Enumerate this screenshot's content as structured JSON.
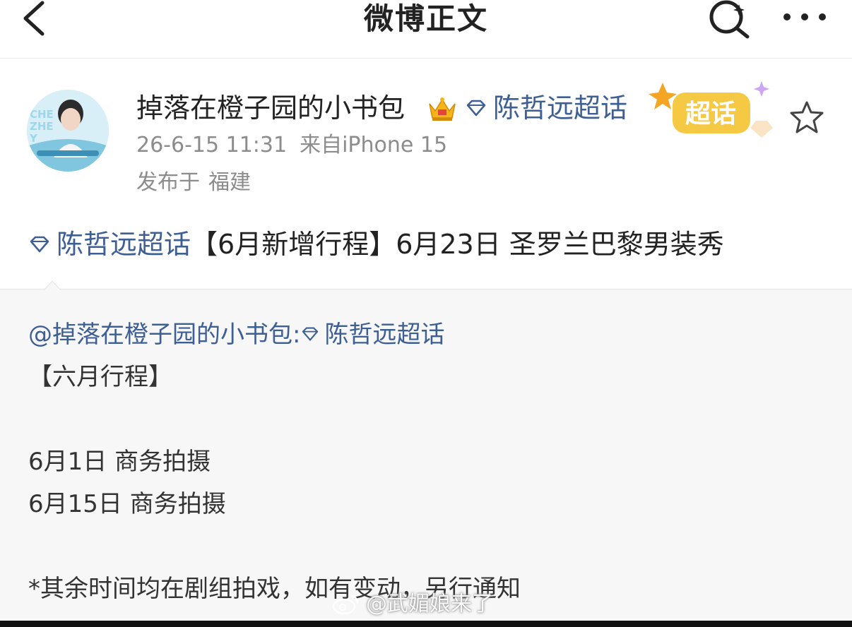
{
  "nav": {
    "title": "微博正文",
    "back_icon": "chevron-left-icon",
    "search_icon": "search-icon",
    "more_icon": "more-dots-icon"
  },
  "post": {
    "author": "掉落在橙子园的小书包",
    "author_topic": "陈哲远超话",
    "time": "26-6-15 11:31",
    "source": "来自iPhone 15",
    "location_prefix": "发布于",
    "location": "福建",
    "badge_text": "超话",
    "avatar_text": [
      "CHE",
      "ZHE",
      "Y"
    ],
    "content_topic": "陈哲远超话",
    "content_text": "【6月新增行程】6月23日 圣罗兰巴黎男装秀"
  },
  "repost": {
    "user": "@掉落在橙子园的小书包:",
    "topic": "陈哲远超话",
    "title": "【六月行程】",
    "line1": "6月1日 商务拍摄",
    "line2": "6月15日 商务拍摄",
    "note": "*其余时间均在剧组拍戏，如有变动，另行通知"
  },
  "watermark": "@武媚娘来了",
  "colors": {
    "link": "#3d5f94",
    "meta_gray": "#8c8c8c",
    "repost_bg": "#f7f7f7",
    "badge_yellow": "#f6c945"
  }
}
